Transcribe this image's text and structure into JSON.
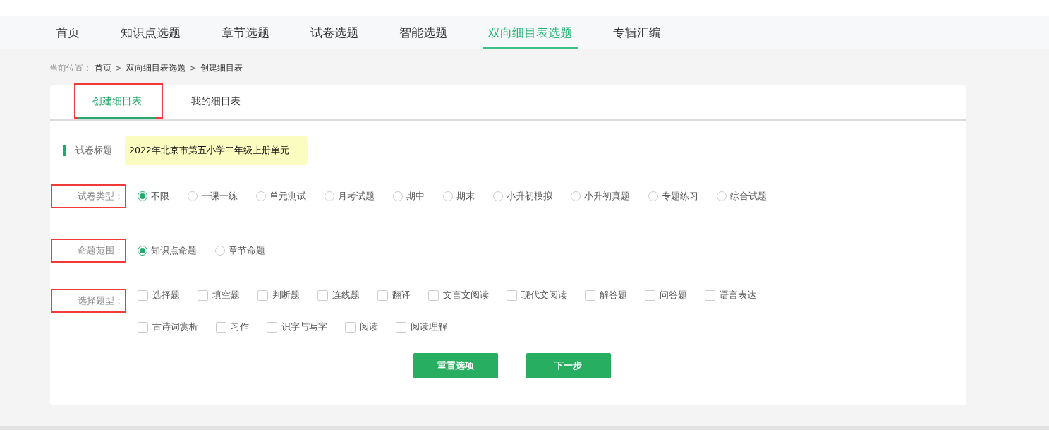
{
  "nav": [
    {
      "label": "首页",
      "selected": false
    },
    {
      "label": "知识点选题",
      "selected": false
    },
    {
      "label": "章节选题",
      "selected": false
    },
    {
      "label": "试卷选题",
      "selected": false
    },
    {
      "label": "智能选题",
      "selected": false
    },
    {
      "label": "双向细目表选题",
      "selected": true
    },
    {
      "label": "专辑汇编",
      "selected": false
    }
  ],
  "breadcrumb": {
    "prefix": "当前位置：",
    "items": [
      "首页",
      "双向细目表选题",
      "创建细目表"
    ],
    "separator": ">"
  },
  "tabs": [
    {
      "label": "创建细目表",
      "selected": true,
      "annotated": true
    },
    {
      "label": "我的细目表",
      "selected": false,
      "annotated": false
    }
  ],
  "title_field": {
    "label": "试卷标题",
    "value": "2022年北京市第五小学二年级上册单元"
  },
  "paper_type": {
    "label": "试卷类型：",
    "annotated": true,
    "options": [
      {
        "label": "不限",
        "selected": true
      },
      {
        "label": "一课一练",
        "selected": false
      },
      {
        "label": "单元测试",
        "selected": false
      },
      {
        "label": "月考试题",
        "selected": false
      },
      {
        "label": "期中",
        "selected": false
      },
      {
        "label": "期末",
        "selected": false
      },
      {
        "label": "小升初模拟",
        "selected": false
      },
      {
        "label": "小升初真题",
        "selected": false
      },
      {
        "label": "专题练习",
        "selected": false
      },
      {
        "label": "综合试题",
        "selected": false
      }
    ]
  },
  "scope": {
    "label": "命题范围：",
    "annotated": true,
    "options": [
      {
        "label": "知识点命题",
        "selected": true
      },
      {
        "label": "章节命题",
        "selected": false
      }
    ]
  },
  "question_types": {
    "label": "选择题型：",
    "annotated": true,
    "rows": [
      [
        {
          "label": "选择题",
          "checked": false
        },
        {
          "label": "填空题",
          "checked": false
        },
        {
          "label": "判断题",
          "checked": false
        },
        {
          "label": "连线题",
          "checked": false
        },
        {
          "label": "翻译",
          "checked": false
        },
        {
          "label": "文言文阅读",
          "checked": false
        },
        {
          "label": "现代文阅读",
          "checked": false
        },
        {
          "label": "解答题",
          "checked": false
        },
        {
          "label": "问答题",
          "checked": false
        },
        {
          "label": "语言表达",
          "checked": false
        }
      ],
      [
        {
          "label": "古诗词赏析",
          "checked": false
        },
        {
          "label": "习作",
          "checked": false
        },
        {
          "label": "识字与写字",
          "checked": false
        },
        {
          "label": "阅读",
          "checked": false
        },
        {
          "label": "阅读理解",
          "checked": false
        }
      ]
    ]
  },
  "buttons": [
    "重置选项",
    "下一步"
  ]
}
